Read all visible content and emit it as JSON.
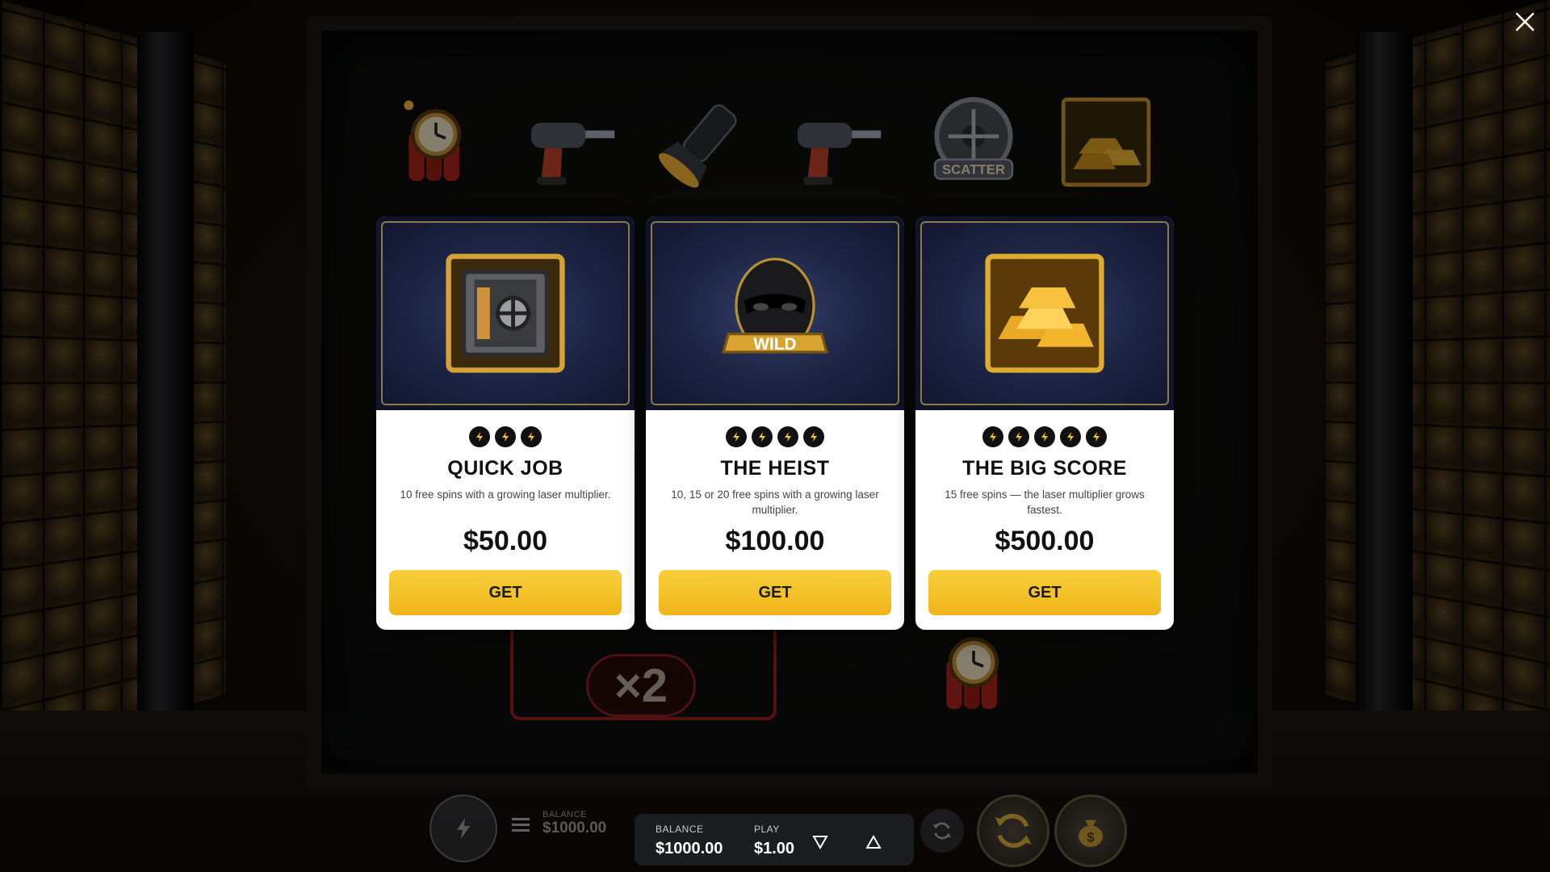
{
  "offers": [
    {
      "title": "QUICK JOB",
      "description": "10 free spins with a growing laser multiplier.",
      "price": "$50.00",
      "button_label": "GET",
      "bolts": 3,
      "art_icon": "safe-icon"
    },
    {
      "title": "THE HEIST",
      "description": "10, 15 or 20 free spins with a growing laser multiplier.",
      "price": "$100.00",
      "button_label": "GET",
      "bolts": 4,
      "art_icon": "wild-thief-icon"
    },
    {
      "title": "THE BIG SCORE",
      "description": "15 free spins — the laser multiplier grows fastest.",
      "price": "$500.00",
      "button_label": "GET",
      "bolts": 5,
      "art_icon": "gold-bars-icon"
    }
  ],
  "reels": {
    "scatter_label": "SCATTER",
    "wild_label": "WILD",
    "multiplier": "×2"
  },
  "hud": {
    "balance_label": "BALANCE",
    "balance_value": "$1000.00",
    "play_label": "PLAY",
    "play_value": "$1.00"
  },
  "background_hud": {
    "balance_label": "BALANCE",
    "balance_value": "$1000.00"
  },
  "colors": {
    "accent": "#f4c22b",
    "card_background": "#ffffff",
    "hud_background": "#1b1d21"
  }
}
